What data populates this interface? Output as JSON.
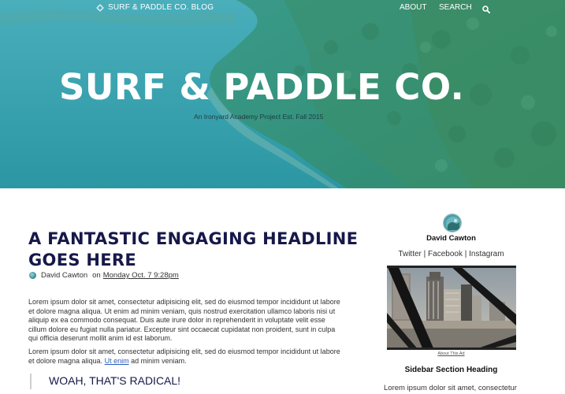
{
  "nav": {
    "brand": "SURF & PADDLE CO. BLOG",
    "about": "ABOUT",
    "search": "SEARCH"
  },
  "hero": {
    "title": "SURF & PADDLE CO.",
    "subtitle": "An Ironyard Academy Project Est. Fall 2015"
  },
  "post": {
    "title": "A FANTASTIC ENGAGING HEADLINE GOES HERE",
    "author": "David Cawton",
    "on": "on",
    "date": "Monday Oct. 7 9:28pm",
    "paragraph1": "Lorem ipsum dolor sit amet, consectetur adipisicing elit, sed do eiusmod tempor incididunt ut labore et dolore magna aliqua. Ut enim ad minim veniam, quis nostrud exercitation ullamco laboris nisi ut aliquip ex ea commodo consequat. Duis aute irure dolor in reprehenderit in voluptate velit esse cillum dolore eu fugiat nulla pariatur. Excepteur sint occaecat cupidatat non proident, sunt in culpa qui officia deserunt mollit anim id est laborum.",
    "paragraph2_before": "Lorem ipsum dolor sit amet, consectetur adipisicing elit, sed do eiusmod tempor incididunt ut labore et dolore magna aliqua. ",
    "paragraph2_link": "Ut enim",
    "paragraph2_after": " ad minim veniam.",
    "blockquote": "WOAH, THAT'S RADICAL!"
  },
  "sidebar": {
    "name": "David Cawton",
    "twitter": "Twitter",
    "facebook": "Facebook",
    "instagram": "Instagram",
    "separator": " | ",
    "ad_caption": "About This Ad",
    "heading": "Sidebar Section Heading",
    "text": "Lorem ipsum dolor sit amet, consectetur"
  },
  "icons": {
    "brand": "sun-icon",
    "search": "search-icon"
  },
  "colors": {
    "headline": "#16184a",
    "hero_overlay": "#2d9aa6",
    "link": "#2a5fbd"
  }
}
